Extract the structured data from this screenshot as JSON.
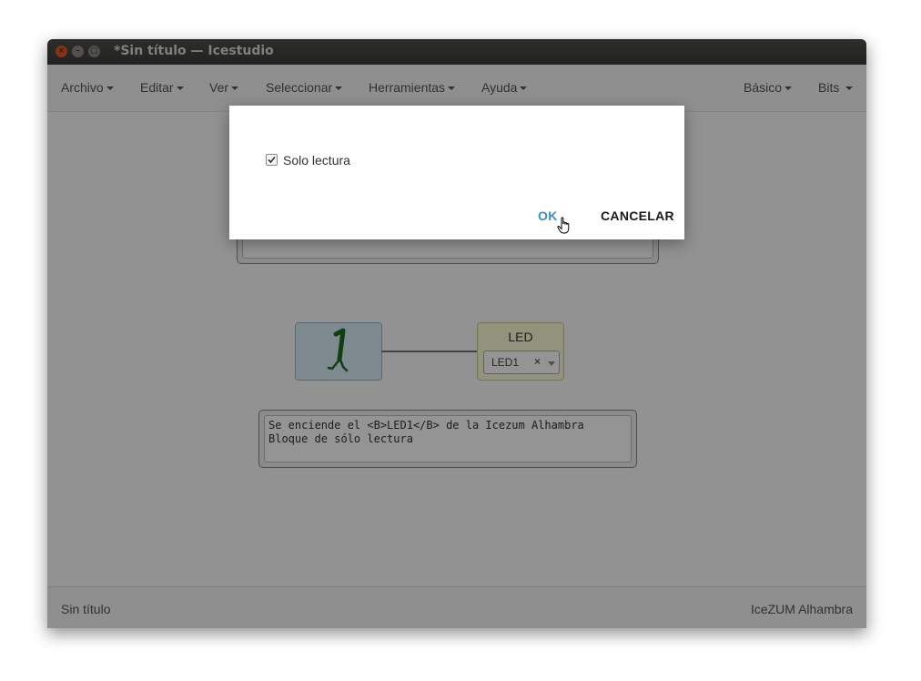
{
  "window": {
    "title": "*Sin título — Icestudio",
    "close_glyph": "×",
    "min_glyph": "–",
    "max_glyph": "□"
  },
  "menubar": {
    "items": [
      "Archivo",
      "Editar",
      "Ver",
      "Seleccionar",
      "Herramientas",
      "Ayuda"
    ],
    "right_items": [
      "Básico",
      "Bits"
    ]
  },
  "canvas": {
    "constant_value": "1",
    "led_block": {
      "title": "LED",
      "selected": "LED1",
      "clear_glyph": "×"
    },
    "info_text": "Se enciende el <B>LED1</B> de la Icezum Alhambra\nBloque de sólo lectura"
  },
  "statusbar": {
    "left": "Sin título",
    "right": "IceZUM Alhambra"
  },
  "dialog": {
    "checkbox_label": "Solo lectura",
    "checkbox_checked": true,
    "ok_label": "OK",
    "cancel_label": "CANCELAR"
  },
  "colors": {
    "ok": "#3a8fc5",
    "titlebar": "#3c3b37",
    "close_button": "#e0582a"
  }
}
